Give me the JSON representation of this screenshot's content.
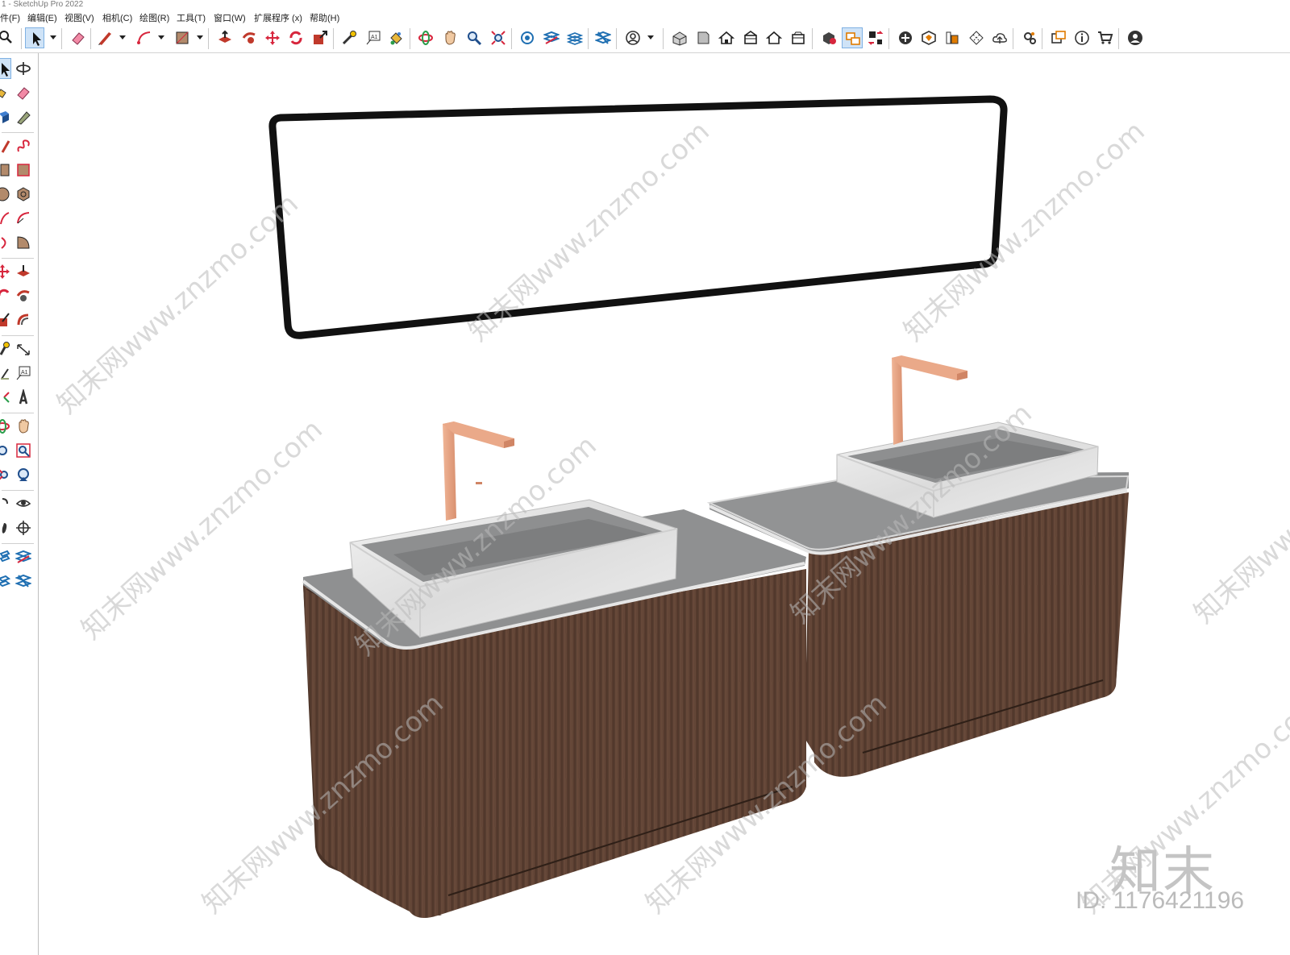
{
  "window": {
    "title": "1 - SketchUp Pro 2022"
  },
  "menu": [
    "件(F)",
    "编辑(E)",
    "视图(V)",
    "相机(C)",
    "绘图(R)",
    "工具(T)",
    "窗口(W)",
    "扩展程序 (x)",
    "帮助(H)"
  ],
  "toolbar": {
    "icons": [
      "search-icon",
      "select-icon",
      "eraser-icon",
      "pencil-line-icon",
      "arc-icon",
      "shape-rectangle-icon",
      "push-pull-icon",
      "follow-me-icon",
      "move-icon",
      "rotate-icon",
      "scale-icon",
      "tape-measure-icon",
      "text-icon",
      "paint-bucket-icon",
      "orbit-icon",
      "pan-icon",
      "zoom-icon",
      "zoom-extents-icon",
      "sandbox-from-contours-icon",
      "sandbox-smoove-icon",
      "sandbox-stamp-icon",
      "sandbox-drape-icon",
      "user-account-icon",
      "iso-view-icon",
      "top-view-icon",
      "front-view-icon",
      "right-view-icon",
      "back-view-icon",
      "left-view-icon",
      "3d-warehouse-icon",
      "component-swap-icon",
      "extension-warehouse-icon",
      "add-location-icon",
      "solid-tools-icon",
      "layout-icon",
      "dimension-grid-icon",
      "cloud-upload-icon",
      "model-info-icon",
      "send-to-layout-icon",
      "info-icon",
      "shop-cart-icon",
      "profile-icon"
    ]
  },
  "left_toolbar": {
    "icons": [
      "select-icon",
      "orbit-icon",
      "paint-bucket-icon",
      "eraser-icon",
      "component-icon",
      "tape-icon",
      "line-icon",
      "freehand-icon",
      "rectangle-icon",
      "rotated-rectangle-icon",
      "circle-icon",
      "polygon-icon",
      "arc-icon",
      "pie-icon",
      "two-point-arc-icon",
      "three-point-arc-icon",
      "move-icon",
      "push-pull-icon",
      "rotate-icon",
      "follow-me-icon",
      "scale-icon",
      "offset-icon",
      "tape-measure-icon",
      "dimension-icon",
      "protractor-icon",
      "text-icon",
      "axes-icon",
      "3d-text-icon",
      "orbit-icon",
      "pan-icon",
      "zoom-icon",
      "zoom-window-icon",
      "zoom-extents-icon",
      "previous-view-icon",
      "position-camera-icon",
      "look-around-icon",
      "walk-icon",
      "section-plane-icon",
      "sandbox-icon",
      "sandbox-drape-icon"
    ]
  },
  "viewport": {
    "background": "#ffffff"
  },
  "colors": {
    "wood": "#5b4033",
    "wood_dark": "#4a3327",
    "marble": "#e8e8e8",
    "countertop": "#8f9091",
    "faucet": "#e8a787",
    "mirror_frame": "#1a1a1a"
  },
  "watermark": {
    "text": "知末网www.znzmo.com"
  },
  "brand": {
    "logo": "知末",
    "id": "ID: 1176421196"
  }
}
